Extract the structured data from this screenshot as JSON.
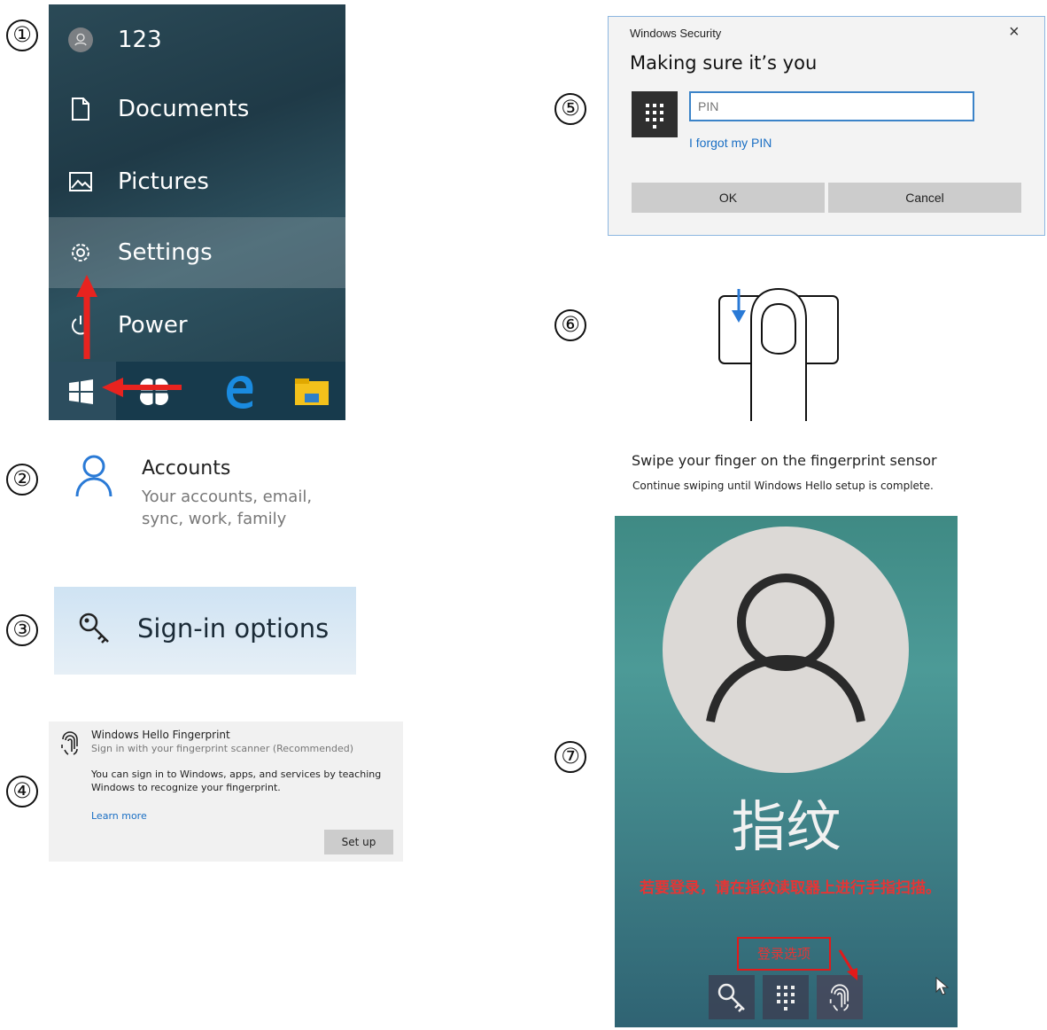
{
  "steps": [
    "①",
    "②",
    "③",
    "④",
    "⑤",
    "⑥",
    "⑦"
  ],
  "start_menu": {
    "user": "123",
    "documents": "Documents",
    "pictures": "Pictures",
    "settings": "Settings",
    "power": "Power",
    "arrow_color": "#e8231f"
  },
  "accounts": {
    "title": "Accounts",
    "description": "Your accounts, email, sync, work, family"
  },
  "signin_options": {
    "label": "Sign-in options"
  },
  "hello_fingerprint": {
    "title": "Windows Hello Fingerprint",
    "subtitle": "Sign in with your fingerprint scanner (Recommended)",
    "body": "You can sign in to Windows, apps, and services by teaching Windows to recognize your fingerprint.",
    "learn_more": "Learn more",
    "setup_button": "Set up"
  },
  "security_dialog": {
    "window_title": "Windows Security",
    "close": "×",
    "heading": "Making sure it’s you",
    "pin_placeholder": "PIN",
    "forgot_pin": "I forgot my PIN",
    "ok": "OK",
    "cancel": "Cancel"
  },
  "fingerprint_setup": {
    "title": "Swipe your finger on the fingerprint sensor",
    "subtitle": "Continue swiping until Windows Hello setup is complete."
  },
  "lock_screen": {
    "heading": "指纹",
    "prompt": "若要登录，请在指纹读取器上进行手指扫描。",
    "signin_options": "登录选项",
    "option_icons": [
      "key-icon",
      "pin-keypad-icon",
      "fingerprint-icon"
    ]
  }
}
